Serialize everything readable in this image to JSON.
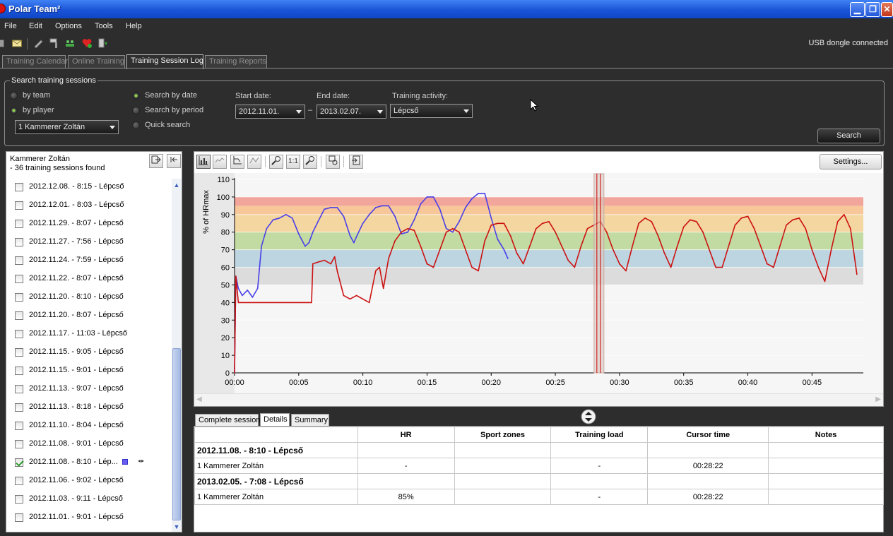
{
  "window": {
    "title": "Polar Team²",
    "min": "▁",
    "max": "❐",
    "close": "✕"
  },
  "menu": [
    "File",
    "Edit",
    "Options",
    "Tools",
    "Help"
  ],
  "status": "USB dongle connected",
  "tabs": [
    {
      "label": "Training Calendar",
      "active": false
    },
    {
      "label": "Online Training",
      "active": false
    },
    {
      "label": "Training Session Log",
      "active": true
    },
    {
      "label": "Training Reports",
      "active": false
    }
  ],
  "search": {
    "legend": "Search training sessions",
    "by_team": "by team",
    "by_player": "by player",
    "player_select": "1 Kammerer Zoltán",
    "by_date": "Search by date",
    "by_period": "Search by period",
    "quick": "Quick search",
    "start_label": "Start date:",
    "start_value": "2012.11.01.",
    "dash": "–",
    "end_label": "End date:",
    "end_value": "2013.02.07.",
    "activity_label": "Training activity:",
    "activity_value": "Lépcső",
    "button": "Search"
  },
  "sessions_panel": {
    "player": "Kammerer Zoltán",
    "count": "- 36 training sessions found",
    "items": [
      {
        "label": "2012.12.08. - 8:15 - Lépcső",
        "checked": false
      },
      {
        "label": "2012.12.01. - 8:03 - Lépcső",
        "checked": false
      },
      {
        "label": "2012.11.29. - 8:07 - Lépcső",
        "checked": false
      },
      {
        "label": "2012.11.27. - 7:56 - Lépcső",
        "checked": false
      },
      {
        "label": "2012.11.24. - 7:59 - Lépcső",
        "checked": false
      },
      {
        "label": "2012.11.22. - 8:07 - Lépcső",
        "checked": false
      },
      {
        "label": "2012.11.20. - 8:10 - Lépcső",
        "checked": false
      },
      {
        "label": "2012.11.20. - 8:07 - Lépcső",
        "checked": false
      },
      {
        "label": "2012.11.17. - 11:03 - Lépcső",
        "checked": false
      },
      {
        "label": "2012.11.15. - 9:05 - Lépcső",
        "checked": false
      },
      {
        "label": "2012.11.15. - 9:01 - Lépcső",
        "checked": false
      },
      {
        "label": "2012.11.13. - 9:07 - Lépcső",
        "checked": false
      },
      {
        "label": "2012.11.13. - 8:18 - Lépcső",
        "checked": false
      },
      {
        "label": "2012.11.10. - 8:04 - Lépcső",
        "checked": false
      },
      {
        "label": "2012.11.08. - 9:01 - Lépcső",
        "checked": false
      },
      {
        "label": "2012.11.08. - 8:10 - Lép...",
        "checked": true
      },
      {
        "label": "2012.11.06. - 9:02 - Lépcső",
        "checked": false
      },
      {
        "label": "2012.11.03. - 9:11 - Lépcső",
        "checked": false
      },
      {
        "label": "2012.11.01. - 9:01 - Lépcső",
        "checked": false
      }
    ]
  },
  "chart_toolbar": {
    "settings": "Settings...",
    "one_to_one": "1:1"
  },
  "chart_data": {
    "type": "line",
    "ylabel": "% of HRmax",
    "ylim": [
      0,
      110
    ],
    "yticks": [
      0,
      10,
      20,
      30,
      40,
      50,
      60,
      70,
      80,
      90,
      100,
      110
    ],
    "xlim": [
      0,
      49
    ],
    "xticks": [
      "00:00",
      "00:05",
      "00:10",
      "00:15",
      "00:20",
      "00:25",
      "00:30",
      "00:35",
      "00:40",
      "00:45"
    ],
    "xtick_minutes": [
      0,
      5,
      10,
      15,
      20,
      25,
      30,
      35,
      40,
      45
    ],
    "zones": [
      {
        "from": 50,
        "to": 60,
        "color": "#dcdcdc"
      },
      {
        "from": 60,
        "to": 70,
        "color": "#bdd5e0"
      },
      {
        "from": 70,
        "to": 80,
        "color": "#c2dba2"
      },
      {
        "from": 80,
        "to": 90,
        "color": "#f3d6a0"
      },
      {
        "from": 90,
        "to": 95,
        "color": "#f7c79a"
      },
      {
        "from": 95,
        "to": 100,
        "color": "#f2a59a"
      }
    ],
    "cursor_minute": 28.4,
    "series": [
      {
        "color": "#4a3ee8",
        "x": [
          0,
          0.1,
          0.3,
          0.6,
          1.0,
          1.4,
          1.8,
          2.1,
          2.5,
          3.0,
          3.5,
          4.0,
          4.5,
          5.0,
          5.5,
          5.8,
          6.1,
          6.5,
          7.0,
          7.5,
          8.0,
          8.5,
          9.0,
          9.3,
          9.6,
          10.0,
          10.5,
          11.0,
          11.5,
          12.0,
          12.5,
          13.0,
          13.5,
          14.0,
          14.5,
          15.0,
          15.5,
          16.0,
          16.5,
          17.0,
          17.5,
          18.0,
          18.5,
          19.0,
          19.5,
          20.0,
          20.5,
          21.0,
          21.3
        ],
        "y": [
          0,
          55,
          48,
          44,
          47,
          43,
          48,
          72,
          82,
          87,
          88,
          90,
          88,
          79,
          72,
          74,
          80,
          86,
          93,
          94,
          94,
          89,
          78,
          74,
          79,
          85,
          90,
          94,
          95,
          95,
          89,
          79,
          80,
          87,
          96,
          100,
          100,
          93,
          82,
          80,
          86,
          94,
          99,
          102,
          102,
          88,
          76,
          70,
          65
        ]
      },
      {
        "color": "#cc1111",
        "x": [
          0,
          0.1,
          0.3,
          6.0,
          6.1,
          6.5,
          7.0,
          7.5,
          7.8,
          8.0,
          8.5,
          9.0,
          9.5,
          10.0,
          10.5,
          11.0,
          11.3,
          11.6,
          12.0,
          12.5,
          13.0,
          13.5,
          14.0,
          14.5,
          15.0,
          15.5,
          16.0,
          16.5,
          17.0,
          17.5,
          18.0,
          18.5,
          19.0,
          19.5,
          20.0,
          20.5,
          21.0,
          21.5,
          22.0,
          22.5,
          23.0,
          23.5,
          24.0,
          24.5,
          25.0,
          25.5,
          26.0,
          26.5,
          27.0,
          27.5,
          28.0,
          28.5,
          29.0,
          29.5,
          30.0,
          30.5,
          31.0,
          31.5,
          32.0,
          32.5,
          33.0,
          33.5,
          34.0,
          34.5,
          35.0,
          35.5,
          36.0,
          36.5,
          37.0,
          37.5,
          38.0,
          38.5,
          39.0,
          39.5,
          40.0,
          40.5,
          41.0,
          41.5,
          42.0,
          42.5,
          43.0,
          43.5,
          44.0,
          44.5,
          45.0,
          45.5,
          46.0,
          46.5,
          47.0,
          47.5,
          48.0,
          48.5
        ],
        "y": [
          0,
          55,
          40,
          40,
          62,
          63,
          64,
          62,
          66,
          58,
          44,
          42,
          44,
          42,
          40,
          58,
          60,
          48,
          65,
          75,
          80,
          82,
          81,
          72,
          62,
          60,
          70,
          80,
          82,
          80,
          70,
          60,
          58,
          75,
          84,
          85,
          85,
          78,
          68,
          62,
          72,
          82,
          85,
          86,
          80,
          72,
          64,
          60,
          72,
          82,
          84,
          86,
          80,
          70,
          62,
          58,
          72,
          85,
          88,
          86,
          78,
          68,
          60,
          72,
          83,
          87,
          86,
          80,
          70,
          60,
          60,
          72,
          84,
          88,
          89,
          82,
          72,
          62,
          60,
          72,
          84,
          87,
          88,
          82,
          70,
          60,
          52,
          70,
          86,
          90,
          82,
          56
        ]
      }
    ]
  },
  "bottom": {
    "tabs": [
      {
        "label": "Complete session",
        "active": false
      },
      {
        "label": "Details",
        "active": true
      },
      {
        "label": "Summary",
        "active": false
      }
    ],
    "headers": [
      "",
      "HR",
      "Sport zones",
      "Training load",
      "Cursor time",
      "Notes"
    ],
    "groups": [
      {
        "title": "2012.11.08. - 8:10 - Lépcső",
        "player": "1 Kammerer Zoltán",
        "hr": "-",
        "zones": "",
        "load": "-",
        "cursor": "00:28:22",
        "notes": ""
      },
      {
        "title": "2013.02.05. - 7:08 - Lépcső",
        "player": "1 Kammerer Zoltán",
        "hr": "85%",
        "zones": "",
        "load": "-",
        "cursor": "00:28:22",
        "notes": ""
      }
    ]
  }
}
